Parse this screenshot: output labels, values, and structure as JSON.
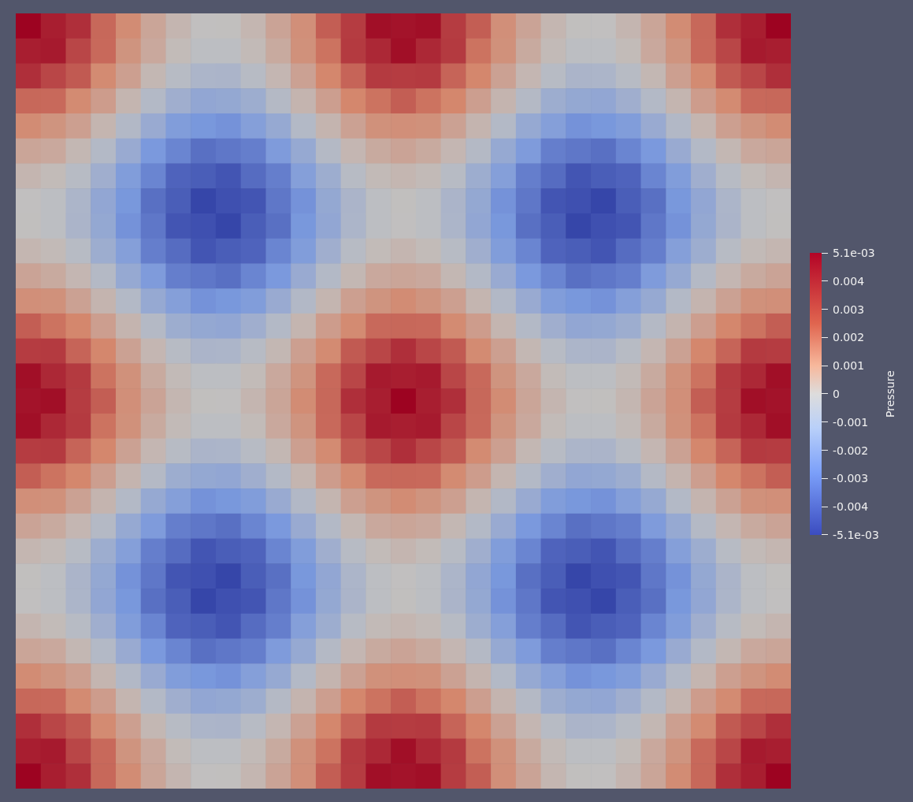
{
  "legend": {
    "title": "Pressure",
    "ticks": [
      "5.1e-03",
      "0.004",
      "0.003",
      "0.002",
      "0.001",
      "0",
      "-0.001",
      "-0.002",
      "-0.003",
      "-0.004",
      "-5.1e-03"
    ]
  }
}
